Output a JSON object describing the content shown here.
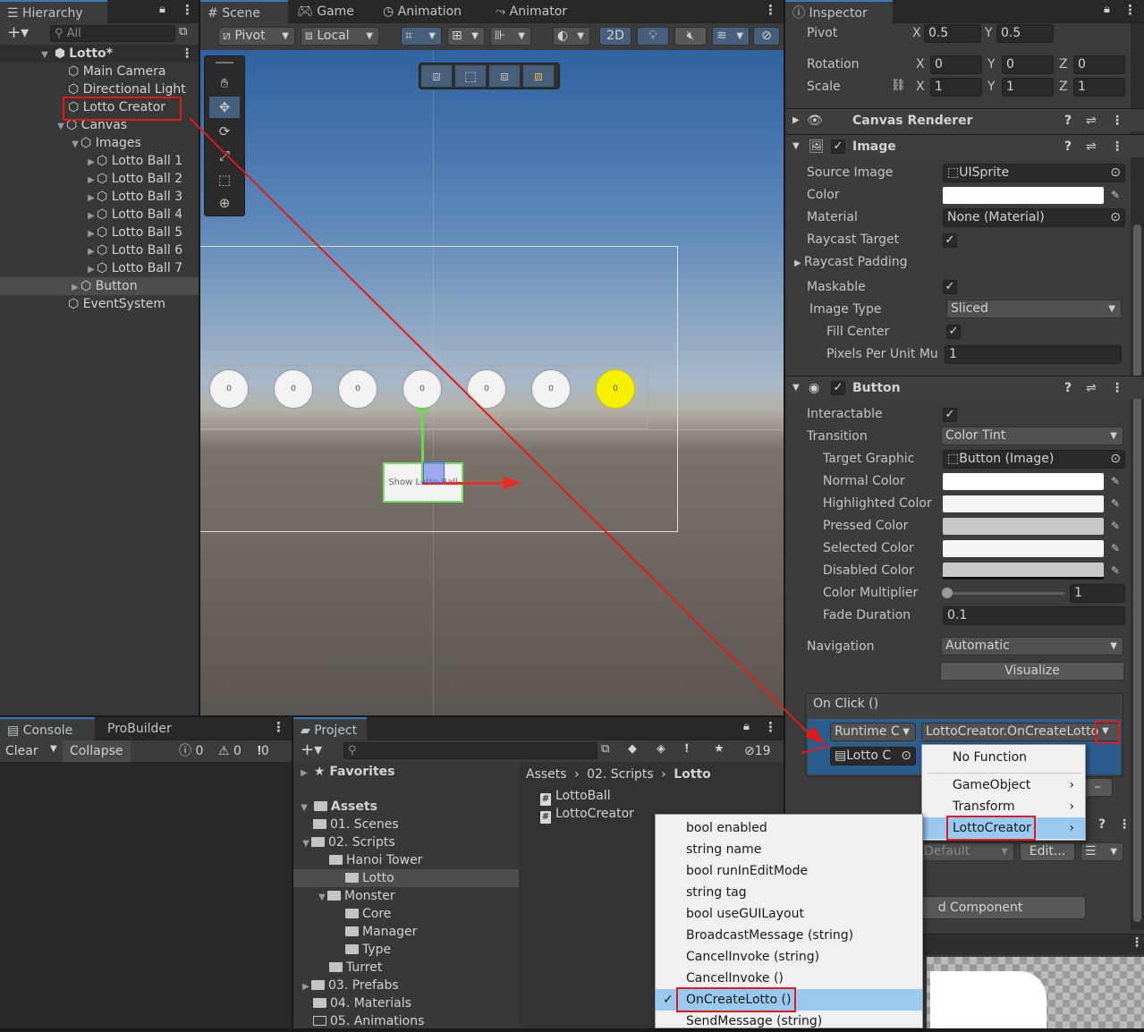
{
  "hierarchy": {
    "tab": "Hierarchy",
    "search_placeholder": "All",
    "scene_name": "Lotto*",
    "items": [
      {
        "label": "Main Camera"
      },
      {
        "label": "Directional Light"
      },
      {
        "label": "Lotto Creator"
      },
      {
        "label": "Canvas"
      },
      {
        "label": "Images"
      },
      {
        "label": "Lotto Ball 1"
      },
      {
        "label": "Lotto Ball 2"
      },
      {
        "label": "Lotto Ball 3"
      },
      {
        "label": "Lotto Ball 4"
      },
      {
        "label": "Lotto Ball 5"
      },
      {
        "label": "Lotto Ball 6"
      },
      {
        "label": "Lotto Ball 7"
      },
      {
        "label": "Button"
      },
      {
        "label": "EventSystem"
      }
    ]
  },
  "scene": {
    "tabs": [
      "Scene",
      "Game",
      "Animation",
      "Animator"
    ],
    "pivot": "Pivot",
    "local": "Local",
    "two_d": "2D",
    "balls": [
      "0",
      "0",
      "0",
      "0",
      "0",
      "0",
      "0"
    ],
    "button_text": "Show Lotto Ball"
  },
  "inspector": {
    "tab": "Inspector",
    "pivot_label": "Pivot",
    "pivot": {
      "x": "0.5",
      "y": "0.5"
    },
    "rotation_label": "Rotation",
    "rotation": {
      "x": "0",
      "y": "0",
      "z": "0"
    },
    "scale_label": "Scale",
    "scale": {
      "x": "1",
      "y": "1",
      "z": "1"
    },
    "axis": {
      "x": "X",
      "y": "Y",
      "z": "Z"
    },
    "canvas_renderer": "Canvas Renderer",
    "image": {
      "title": "Image",
      "source_image_label": "Source Image",
      "source_image": "UISprite",
      "color_label": "Color",
      "material_label": "Material",
      "material": "None (Material)",
      "raycast_target_label": "Raycast Target",
      "raycast_padding_label": "Raycast Padding",
      "maskable_label": "Maskable",
      "image_type_label": "Image Type",
      "image_type": "Sliced",
      "fill_center_label": "Fill Center",
      "ppu_label": "Pixels Per Unit Mu",
      "ppu": "1"
    },
    "button": {
      "title": "Button",
      "interactable_label": "Interactable",
      "transition_label": "Transition",
      "transition": "Color Tint",
      "target_graphic_label": "Target Graphic",
      "target_graphic": "Button (Image)",
      "normal_color_label": "Normal Color",
      "highlighted_color_label": "Highlighted Color",
      "pressed_color_label": "Pressed Color",
      "selected_color_label": "Selected Color",
      "disabled_color_label": "Disabled Color",
      "color_multiplier_label": "Color Multiplier",
      "color_multiplier": "1",
      "fade_duration_label": "Fade Duration",
      "fade_duration": "0.1",
      "navigation_label": "Navigation",
      "navigation": "Automatic",
      "visualize": "Visualize",
      "onclick_label": "On Click ()",
      "runtime": "Runtime C",
      "function": "LottoCreator.OnCreateLotto",
      "object": "Lotto C",
      "minus": "–"
    },
    "default_label": "Default",
    "edit_label": "Edit...",
    "add_component": "d Component",
    "colors": {
      "normal": "#ffffff",
      "highlighted": "#f5f5f5",
      "pressed": "#c8c8c8",
      "selected": "#f5f5f5",
      "disabled": "#c8c8c8"
    }
  },
  "function_menu": {
    "items": [
      {
        "label": "No Function"
      },
      {
        "label": "GameObject",
        "sub": "›"
      },
      {
        "label": "Transform",
        "sub": "›"
      },
      {
        "label": "LottoCreator",
        "sub": "›"
      }
    ]
  },
  "method_menu": {
    "items": [
      {
        "label": "bool enabled"
      },
      {
        "label": "string name"
      },
      {
        "label": "bool runInEditMode"
      },
      {
        "label": "string tag"
      },
      {
        "label": "bool useGUILayout"
      },
      {
        "label": "BroadcastMessage (string)"
      },
      {
        "label": "CancelInvoke (string)"
      },
      {
        "label": "CancelInvoke ()"
      },
      {
        "label": "OnCreateLotto ()"
      },
      {
        "label": "SendMessage (string)"
      }
    ],
    "check": "✓"
  },
  "console": {
    "tabs": [
      "Console",
      "ProBuilder"
    ],
    "clear": "Clear",
    "collapse": "Collapse",
    "counts": [
      "0",
      "0",
      "0"
    ]
  },
  "project": {
    "tab": "Project",
    "hidden_count": "19",
    "favorites": "Favorites",
    "assets": "Assets",
    "folders": [
      {
        "label": "01. Scenes"
      },
      {
        "label": "02. Scripts"
      },
      {
        "label": "Hanoi Tower"
      },
      {
        "label": "Lotto"
      },
      {
        "label": "Monster"
      },
      {
        "label": "Core"
      },
      {
        "label": "Manager"
      },
      {
        "label": "Type"
      },
      {
        "label": "Turret"
      },
      {
        "label": "03. Prefabs"
      },
      {
        "label": "04. Materials"
      },
      {
        "label": "05. Animations"
      }
    ],
    "breadcrumb": [
      "Assets",
      "02. Scripts",
      "Lotto"
    ],
    "files": [
      {
        "label": "LottoBall"
      },
      {
        "label": "LottoCreator"
      }
    ]
  }
}
